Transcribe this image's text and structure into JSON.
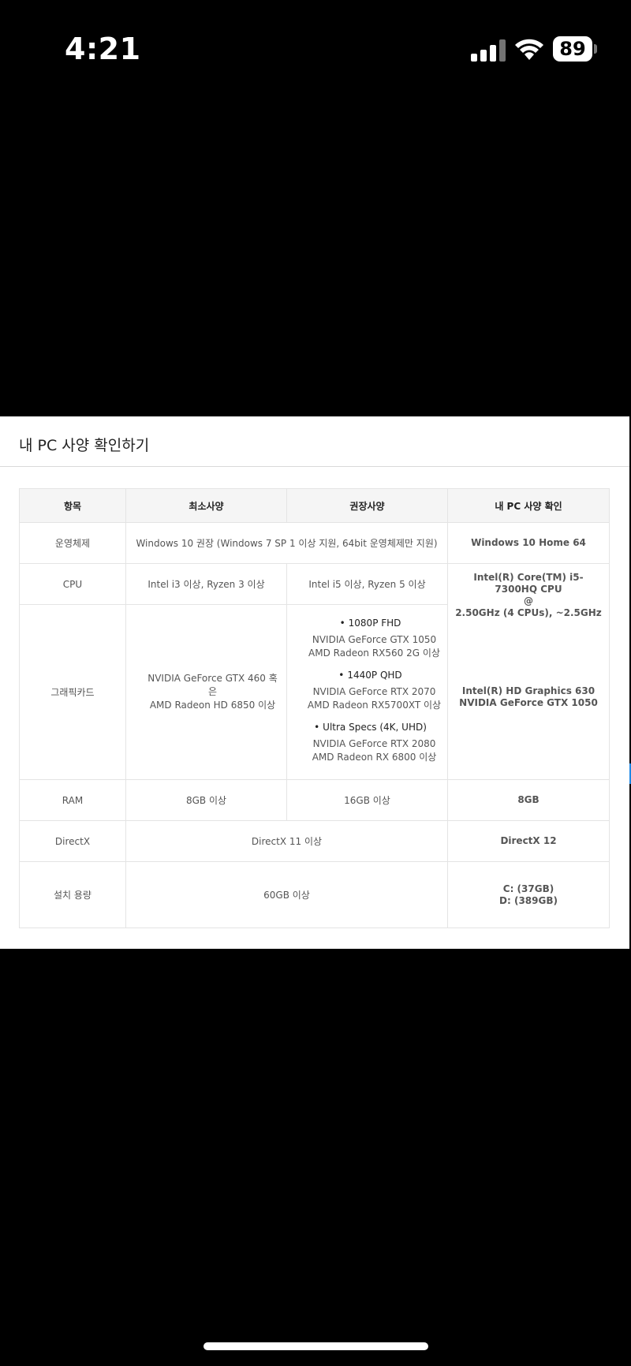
{
  "status_bar": {
    "time": "4:21",
    "battery": "89",
    "icons": [
      "cellular-signal-icon",
      "wifi-icon",
      "battery-icon"
    ]
  },
  "panel": {
    "title": "내 PC 사양 확인하기"
  },
  "table": {
    "headers": [
      "항목",
      "최소사양",
      "권장사양",
      "내 PC 사양 확인"
    ],
    "os": {
      "label": "운영체제",
      "requirement": "Windows 10 권장 (Windows 7 SP 1 이상 지원, 64bit 운영체제만 지원)",
      "mine": "Windows 10 Home 64"
    },
    "cpu": {
      "label": "CPU",
      "min": "Intel i3 이상, Ryzen 3 이상",
      "rec": "Intel i5 이상, Ryzen 5 이상",
      "mine_line1": "Intel(R) Core(TM) i5-7300HQ CPU",
      "mine_line2": "@",
      "mine_line3": "2.50GHz (4 CPUs), ~2.5GHz"
    },
    "gpu": {
      "label": "그래픽카드",
      "min_line1": "NVIDIA GeForce GTX 460 혹은",
      "min_line2": "AMD Radeon HD 6850 이상",
      "rec_groups": [
        {
          "head": "1080P FHD",
          "line1": "NVIDIA GeForce GTX 1050",
          "line2": "AMD Radeon RX560 2G 이상"
        },
        {
          "head": "1440P QHD",
          "line1": "NVIDIA GeForce RTX 2070",
          "line2": "AMD Radeon RX5700XT 이상"
        },
        {
          "head": "Ultra Specs (4K, UHD)",
          "line1": "NVIDIA GeForce RTX 2080",
          "line2": "AMD Radeon RX 6800 이상"
        }
      ],
      "mine_line1": "Intel(R) HD Graphics 630",
      "mine_line2": "NVIDIA GeForce GTX 1050"
    },
    "ram": {
      "label": "RAM",
      "min": "8GB 이상",
      "rec": "16GB 이상",
      "mine": "8GB"
    },
    "directx": {
      "label": "DirectX",
      "requirement": "DirectX 11 이상",
      "mine": "DirectX 12"
    },
    "storage": {
      "label": "설치 용량",
      "requirement": "60GB 이상",
      "mine_line1": "C: (37GB)",
      "mine_line2": "D: (389GB)"
    }
  },
  "colors": {
    "accent": "#7b63e6",
    "header_bg": "#f5f5f5",
    "border": "#e4e4e4"
  }
}
